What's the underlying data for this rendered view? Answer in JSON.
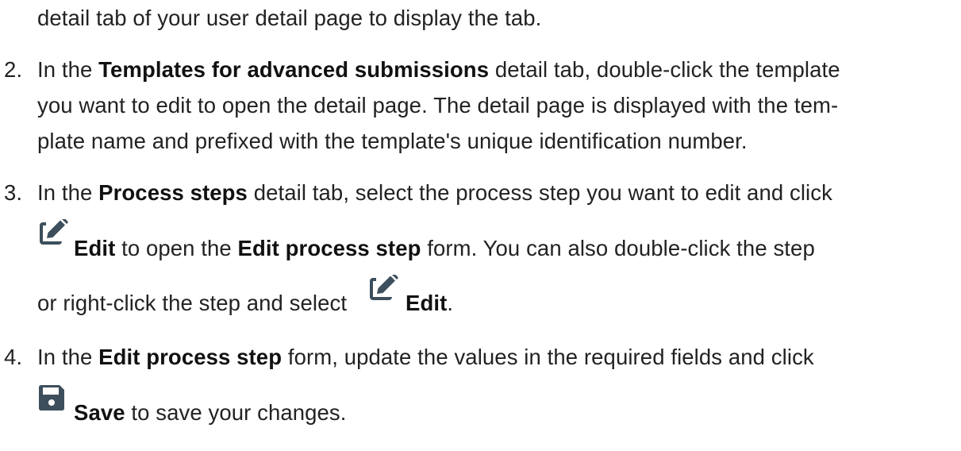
{
  "intro": {
    "line1": "detail tab of your user detail page to display the tab."
  },
  "steps": [
    {
      "number": "2.",
      "pre": "In the ",
      "bold1": "Templates for advanced submissions",
      "mid1": " detail tab, double-click the template",
      "line2": "you want to edit to open the detail page. The detail page is displayed with the tem-",
      "line3": "plate name and prefixed with the template's unique identification number."
    },
    {
      "number": "3.",
      "pre": "In the ",
      "bold1": "Process steps",
      "mid1": " detail tab, select the process step you want to edit and click",
      "edit_label": "Edit",
      "mid2": " to open the ",
      "bold2": "Edit process step",
      "mid3": " form. You can also double-click the step",
      "pre4": "or right-click the step and select ",
      "edit_label2": "Edit",
      "end": "."
    },
    {
      "number": "4.",
      "pre": "In the ",
      "bold1": "Edit process step",
      "mid1": " form, update the values in the required fields and click",
      "save_label": "Save",
      "mid2": " to save your changes."
    }
  ],
  "icons": {
    "edit": "edit-pencil-icon",
    "save": "save-floppy-icon"
  },
  "colors": {
    "icon_fill": "#3d4f5c",
    "text": "#222222"
  }
}
